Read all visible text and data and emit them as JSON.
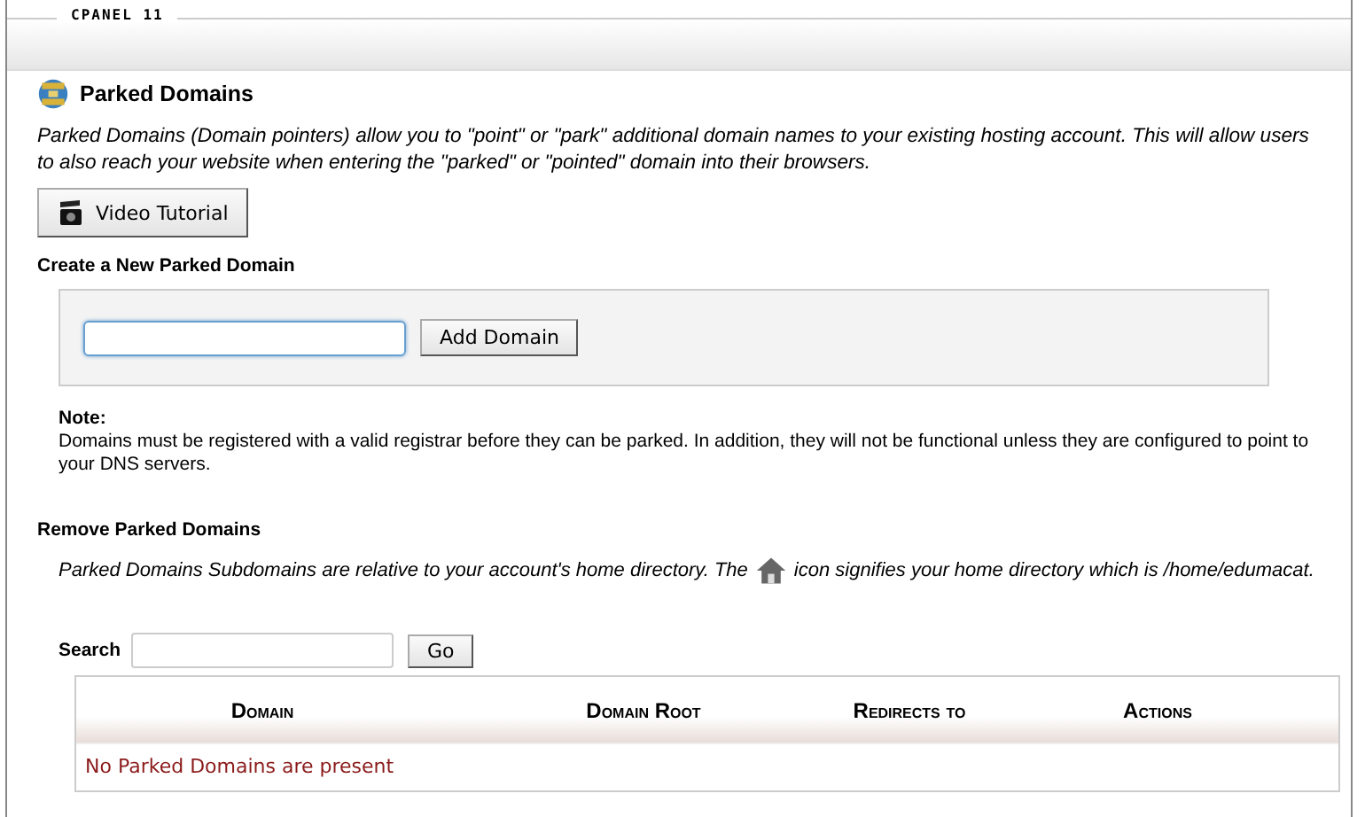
{
  "frame": {
    "label": "CPANEL 11"
  },
  "title": "Parked Domains",
  "intro": "Parked Domains (Domain pointers) allow you to \"point\" or \"park\" additional domain names to your existing hosting account. This will allow users to also reach your website when entering the \"parked\" or \"pointed\" domain into their browsers.",
  "video_button": "Video Tutorial",
  "create": {
    "heading": "Create a New Parked Domain",
    "button": "Add Domain"
  },
  "note": {
    "label": "Note:",
    "text": "Domains must be registered with a valid registrar before they can be parked. In addition, they will not be functional unless they are configured to point to your DNS servers."
  },
  "remove": {
    "heading": "Remove Parked Domains",
    "text_before": "Parked Domains Subdomains are relative to your account's home directory. The",
    "text_after": "icon signifies your home directory which is /home/edumacat."
  },
  "search": {
    "label": "Search",
    "button": "Go"
  },
  "table": {
    "columns": [
      "Domain",
      "Domain Root",
      "Redirects to",
      "Actions"
    ],
    "empty": "No Parked Domains are present"
  }
}
